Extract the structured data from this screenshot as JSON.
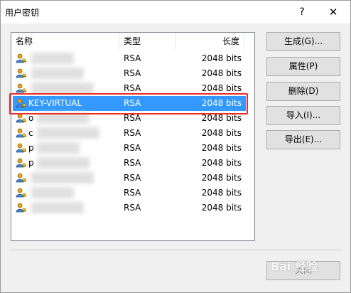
{
  "window": {
    "title": "用户密钥",
    "help": "?",
    "close": "✕"
  },
  "table": {
    "headers": {
      "name": "名称",
      "type": "类型",
      "length": "长度"
    },
    "rows": [
      {
        "name": "",
        "type": "RSA",
        "length": "2048 bits",
        "selected": false
      },
      {
        "name": "",
        "type": "RSA",
        "length": "2048 bits",
        "selected": false
      },
      {
        "name": "",
        "type": "RSA",
        "length": "2048 bits",
        "selected": false
      },
      {
        "name": "KEY-VIRTUAL",
        "type": "RSA",
        "length": "2048 bits",
        "selected": true
      },
      {
        "name": "o",
        "type": "RSA",
        "length": "2048 bits",
        "selected": false
      },
      {
        "name": "c",
        "type": "RSA",
        "length": "2048 bits",
        "selected": false
      },
      {
        "name": "p",
        "type": "RSA",
        "length": "2048 bits",
        "selected": false
      },
      {
        "name": "p",
        "type": "RSA",
        "length": "2048 bits",
        "selected": false
      },
      {
        "name": "",
        "type": "RSA",
        "length": "2048 bits",
        "selected": false
      },
      {
        "name": "",
        "type": "RSA",
        "length": "2048 bits",
        "selected": false
      },
      {
        "name": "",
        "type": "RSA",
        "length": "2048 bits",
        "selected": false
      }
    ]
  },
  "buttons": {
    "generate": "生成(G)...",
    "properties": "属性(P)",
    "delete": "删除(D)",
    "import": "导入(I)...",
    "export": "导出(E)...",
    "close": "关闭"
  },
  "watermark": "Bai 经验"
}
